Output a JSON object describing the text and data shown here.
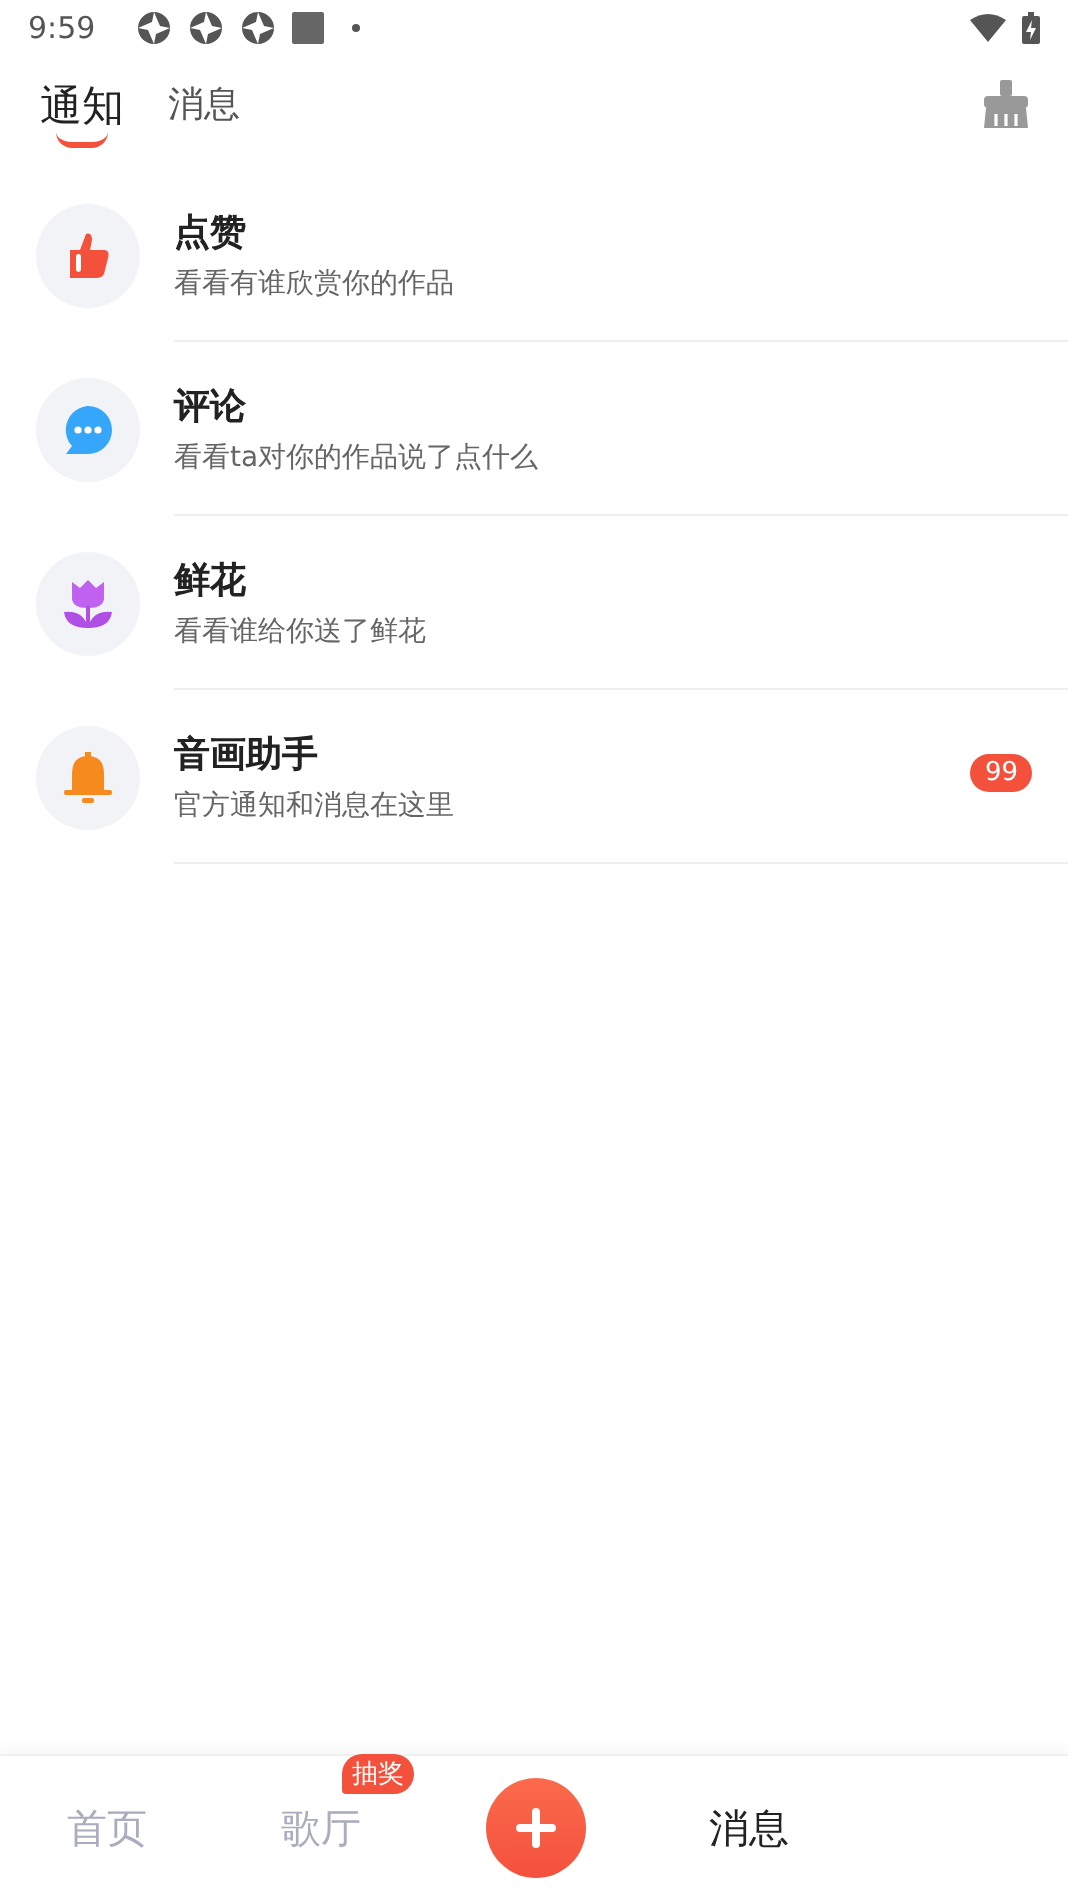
{
  "status_bar": {
    "time": "9:59"
  },
  "tabs": [
    {
      "label": "通知",
      "selected": true
    },
    {
      "label": "消息",
      "selected": false
    }
  ],
  "notifications": [
    {
      "kind": "like",
      "title": "点赞",
      "subtitle": "看看有谁欣赏你的作品"
    },
    {
      "kind": "comment",
      "title": "评论",
      "subtitle": "看看ta对你的作品说了点什么"
    },
    {
      "kind": "flower",
      "title": "鲜花",
      "subtitle": "看看谁给你送了鲜花"
    },
    {
      "kind": "bell",
      "title": "音画助手",
      "subtitle": "官方通知和消息在这里",
      "badge": "99"
    }
  ],
  "bottom_nav": [
    {
      "kind": "tab",
      "label": "首页",
      "selected": false
    },
    {
      "kind": "tab",
      "label": "歌厅",
      "selected": false,
      "badge": "抽奖"
    },
    {
      "kind": "plus"
    },
    {
      "kind": "tab",
      "label": "消息",
      "selected": true
    }
  ]
}
